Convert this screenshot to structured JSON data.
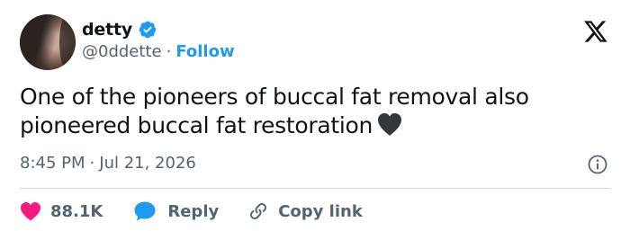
{
  "author": {
    "name": "detty",
    "handle": "@0ddette",
    "separator": "·",
    "follow_label": "Follow",
    "verified": true
  },
  "tweet": {
    "text": "One of the pioneers of buccal fat removal also pioneered buccal fat restoration",
    "emoji": "black-heart-icon",
    "time": "8:45 PM",
    "date": "Jul 21, 2026"
  },
  "actions": {
    "like_count": "88.1K",
    "reply_label": "Reply",
    "copy_link_label": "Copy link"
  },
  "colors": {
    "accent": "#1d9bf0",
    "like": "#f91880",
    "secondary_text": "#536471",
    "divider": "#cfd9de"
  }
}
